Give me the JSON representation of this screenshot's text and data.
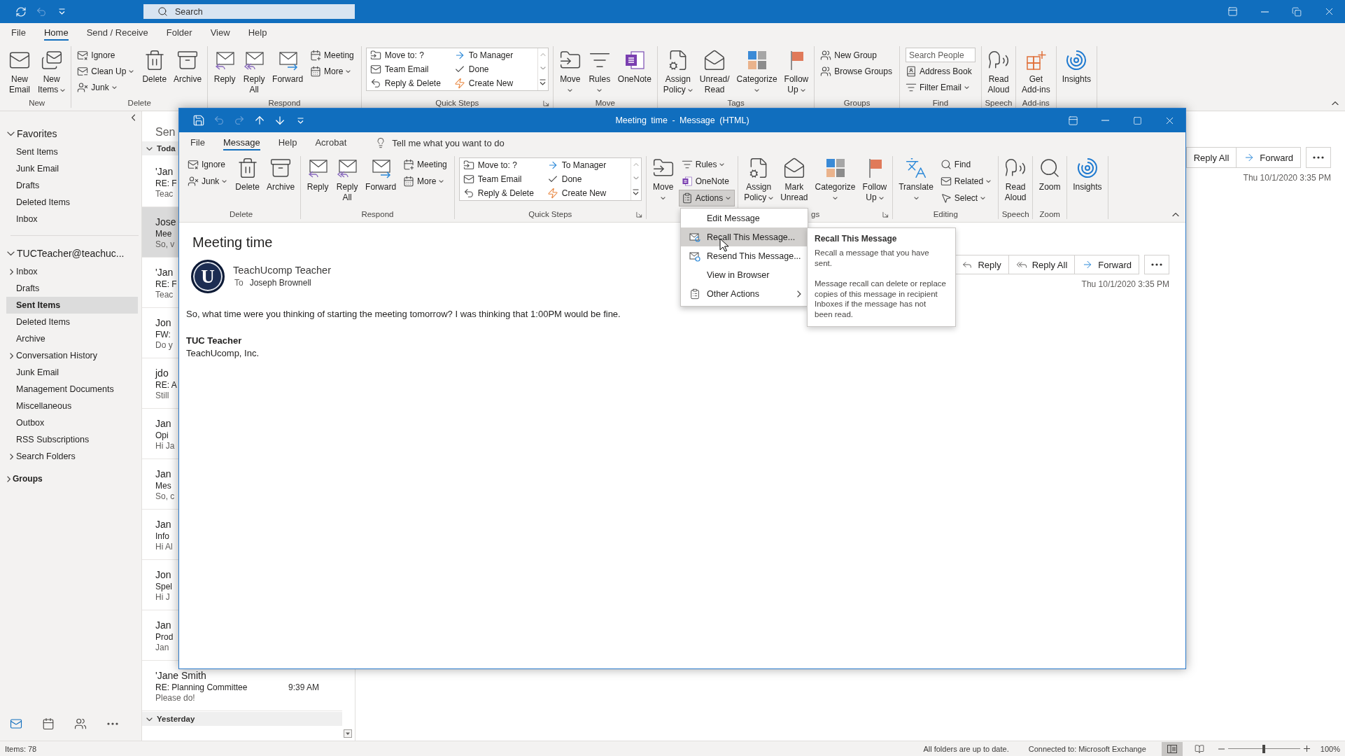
{
  "main_window": {
    "quick_access": [
      {
        "kind": "sync",
        "disabled": false
      },
      {
        "kind": "undo",
        "disabled": true
      },
      {
        "kind": "customize",
        "disabled": false
      }
    ],
    "search": {
      "placeholder": "Search"
    },
    "tabs": [
      {
        "label": "File",
        "selected": false
      },
      {
        "label": "Home",
        "selected": true
      },
      {
        "label": "Send / Receive",
        "selected": false
      },
      {
        "label": "Folder",
        "selected": false
      },
      {
        "label": "View",
        "selected": false
      },
      {
        "label": "Help",
        "selected": false
      }
    ],
    "ribbon": [
      {
        "label": "New",
        "items": [
          {
            "kind": "large",
            "lines": [
              "New",
              "Email"
            ],
            "dropdown": false
          },
          {
            "kind": "large",
            "lines": [
              "New",
              "Items"
            ],
            "dropdown": true
          }
        ]
      },
      {
        "label": "Delete",
        "items": [
          {
            "kind": "stack",
            "buttons": [
              {
                "kind": "button",
                "label": "Ignore",
                "dropdown": false,
                "expanded": false
              },
              {
                "kind": "button",
                "label": "Clean Up",
                "dropdown": true,
                "expanded": false
              },
              {
                "kind": "button",
                "label": "Junk",
                "dropdown": true,
                "expanded": false
              }
            ]
          },
          {
            "kind": "large",
            "lines": [
              "Delete"
            ],
            "dropdown": false
          },
          {
            "kind": "large",
            "lines": [
              "Archive"
            ],
            "dropdown": false
          }
        ]
      },
      {
        "label": "Respond",
        "items": [
          {
            "kind": "large",
            "lines": [
              "Reply"
            ],
            "dropdown": false
          },
          {
            "kind": "large",
            "lines": [
              "Reply",
              "All"
            ],
            "dropdown": false
          },
          {
            "kind": "large",
            "lines": [
              "Forward"
            ],
            "dropdown": false
          },
          {
            "kind": "stack",
            "buttons": [
              {
                "kind": "button",
                "label": "Meeting",
                "dropdown": false,
                "expanded": false
              },
              {
                "kind": "button",
                "label": "More",
                "dropdown": true,
                "expanded": false
              }
            ]
          }
        ]
      },
      {
        "label": "Quick Steps",
        "launcher": true,
        "items": [
          {
            "kind": "gallery",
            "entries": [
              "Move to: ?",
              "Team Email",
              "Reply & Delete",
              "To Manager",
              "Done",
              "Create New"
            ]
          }
        ]
      },
      {
        "label": "Move",
        "items": [
          {
            "kind": "large",
            "lines": [
              "Move"
            ],
            "dropdown": true
          },
          {
            "kind": "large",
            "lines": [
              "Rules"
            ],
            "dropdown": true
          },
          {
            "kind": "large",
            "lines": [
              "OneNote"
            ],
            "dropdown": false
          }
        ]
      },
      {
        "label": "Tags",
        "items": [
          {
            "kind": "large",
            "lines": [
              "Assign",
              "Policy"
            ],
            "dropdown": true
          },
          {
            "kind": "large",
            "lines": [
              "Unread/",
              "Read"
            ],
            "dropdown": false
          },
          {
            "kind": "large",
            "lines": [
              "Categorize"
            ],
            "dropdown": true
          },
          {
            "kind": "large",
            "lines": [
              "Follow",
              "Up"
            ],
            "dropdown": true
          }
        ]
      },
      {
        "label": "Groups",
        "items": [
          {
            "kind": "stack",
            "buttons": [
              {
                "kind": "button",
                "label": "New Group",
                "dropdown": false,
                "expanded": false
              },
              {
                "kind": "button",
                "label": "Browse Groups",
                "dropdown": false,
                "expanded": false
              }
            ]
          }
        ]
      },
      {
        "label": "Find",
        "items": [
          {
            "kind": "stack",
            "buttons": [
              {
                "kind": "field",
                "placeholder": "Search People"
              },
              {
                "kind": "button",
                "label": "Address Book",
                "dropdown": false,
                "expanded": false
              },
              {
                "kind": "button",
                "label": "Filter Email",
                "dropdown": true,
                "expanded": false
              }
            ]
          }
        ]
      },
      {
        "label": "Speech",
        "items": [
          {
            "kind": "large",
            "lines": [
              "Read",
              "Aloud"
            ],
            "dropdown": false
          }
        ]
      },
      {
        "label": "Add-ins",
        "items": [
          {
            "kind": "large",
            "lines": [
              "Get",
              "Add-ins"
            ],
            "dropdown": false
          }
        ]
      },
      {
        "items": [
          {
            "kind": "large",
            "lines": [
              "Insights"
            ],
            "dropdown": false
          }
        ]
      }
    ],
    "folder_pane": {
      "sections": [
        {
          "label": "Favorites",
          "kind": "pane",
          "expanded": true,
          "children": [
            {
              "label": "Sent Items",
              "expandable": false,
              "selected": false
            },
            {
              "label": "Junk Email",
              "expandable": false,
              "selected": false
            },
            {
              "label": "Drafts",
              "expandable": false,
              "selected": false
            },
            {
              "label": "Deleted Items",
              "expandable": false,
              "selected": false
            },
            {
              "label": "Inbox",
              "expandable": false,
              "selected": false
            }
          ]
        },
        {
          "label": "TUCTeacher@teachuc...",
          "kind": "pane",
          "expanded": true,
          "children": [
            {
              "label": "Inbox",
              "expandable": true,
              "selected": false
            },
            {
              "label": "Drafts",
              "expandable": false,
              "selected": false
            },
            {
              "label": "Sent Items",
              "expandable": false,
              "selected": true
            },
            {
              "label": "Deleted Items",
              "expandable": false,
              "selected": false
            },
            {
              "label": "Archive",
              "expandable": false,
              "selected": false
            },
            {
              "label": "Conversation History",
              "expandable": true,
              "selected": false
            },
            {
              "label": "Junk Email",
              "expandable": false,
              "selected": false
            },
            {
              "label": "Management Documents",
              "expandable": false,
              "selected": false
            },
            {
              "label": "Miscellaneous",
              "expandable": false,
              "selected": false
            },
            {
              "label": "Outbox",
              "expandable": false,
              "selected": false
            },
            {
              "label": "RSS Subscriptions",
              "expandable": false,
              "selected": false
            },
            {
              "label": "Search Folders",
              "expandable": true,
              "selected": false
            }
          ]
        },
        {
          "label": "Groups",
          "kind": "groups",
          "expanded": false
        }
      ]
    },
    "nav": [
      {
        "kind": "mail",
        "selected": true
      },
      {
        "kind": "calendar",
        "selected": false
      },
      {
        "kind": "people",
        "selected": false
      },
      {
        "kind": "more",
        "selected": false
      }
    ],
    "message_list": {
      "title": "Sen",
      "groups": [
        {
          "label": "Toda",
          "expanded": true,
          "messages": [
            {
              "sender": "'Jan",
              "subject": "RE: F",
              "preview": "Teac",
              "selected": false
            },
            {
              "sender": "Jose",
              "subject": "Mee",
              "preview": "So, v",
              "selected": true
            },
            {
              "sender": "'Jan",
              "subject": "RE: F",
              "preview": "Teac",
              "selected": false
            },
            {
              "sender": "Jon",
              "subject": "FW:",
              "preview": "Do y",
              "selected": false
            },
            {
              "sender": "jdo",
              "subject": "RE: A",
              "preview": "Still",
              "selected": false
            },
            {
              "sender": "Jan",
              "subject": "Opi",
              "preview": "Hi Ja",
              "selected": false
            },
            {
              "sender": "Jan",
              "subject": "Mes",
              "preview": "So, c",
              "selected": false
            },
            {
              "sender": "Jan",
              "subject": "Info",
              "preview": "Hi Al",
              "selected": false
            },
            {
              "sender": "Jon",
              "subject": "Spel",
              "preview": "Hi J",
              "selected": false
            },
            {
              "sender": "Jan",
              "subject": "Prod",
              "preview": "Jan",
              "selected": false
            },
            {
              "sender": "'Jane Smith",
              "subject": "RE: Planning Committee",
              "time": "9:39 AM",
              "preview": "Please do!",
              "selected": false
            }
          ]
        },
        {
          "label": "Yesterday",
          "expanded": true
        }
      ]
    },
    "reading_pane": {
      "actions": [
        {
          "label": "Reply All",
          "icon": false
        },
        {
          "label": "Forward",
          "icon": true
        }
      ],
      "date": "Thu 10/1/2020 3:35 PM"
    },
    "status_bar": {
      "items": "Items: 78",
      "sync": "All folders are up to date.",
      "connection": "Connected to: Microsoft Exchange",
      "views": [
        {
          "kind": "normal",
          "selected": true
        },
        {
          "kind": "reading",
          "selected": false
        }
      ],
      "zoom": {
        "level": 0.5,
        "reading": "100%"
      }
    }
  },
  "message_window": {
    "title": "Meeting time - Message (HTML)",
    "quick_access": [
      {
        "kind": "save",
        "disabled": false
      },
      {
        "kind": "undo",
        "disabled": true
      },
      {
        "kind": "redo",
        "disabled": true
      },
      {
        "kind": "up",
        "disabled": false
      },
      {
        "kind": "down",
        "disabled": false
      },
      {
        "kind": "customize",
        "disabled": false
      }
    ],
    "tabs": [
      {
        "label": "File",
        "selected": false
      },
      {
        "label": "Message",
        "selected": true
      },
      {
        "label": "Help",
        "selected": false
      },
      {
        "label": "Acrobat",
        "selected": false
      }
    ],
    "tell_me": {
      "placeholder": "Tell me what you want to do"
    },
    "ribbon": [
      {
        "label": "Delete",
        "items": [
          {
            "kind": "stack",
            "buttons": [
              {
                "kind": "button",
                "label": "Ignore",
                "dropdown": false,
                "expanded": false
              },
              {
                "kind": "button",
                "label": "Junk",
                "dropdown": true,
                "expanded": false
              }
            ]
          },
          {
            "kind": "large",
            "lines": [
              "Delete"
            ],
            "dropdown": false
          },
          {
            "kind": "large",
            "lines": [
              "Archive"
            ],
            "dropdown": false
          }
        ]
      },
      {
        "label": "Respond",
        "items": [
          {
            "kind": "large",
            "lines": [
              "Reply"
            ],
            "dropdown": false
          },
          {
            "kind": "large",
            "lines": [
              "Reply",
              "All"
            ],
            "dropdown": false
          },
          {
            "kind": "large",
            "lines": [
              "Forward"
            ],
            "dropdown": false
          },
          {
            "kind": "stack",
            "buttons": [
              {
                "kind": "button",
                "label": "Meeting",
                "dropdown": false,
                "expanded": false
              },
              {
                "kind": "button",
                "label": "More",
                "dropdown": true,
                "expanded": false
              }
            ]
          }
        ]
      },
      {
        "label": "Quick Steps",
        "launcher": true,
        "items": [
          {
            "kind": "gallery",
            "entries": [
              "Move to: ?",
              "Team Email",
              "Reply & Delete",
              "To Manager",
              "Done",
              "Create New"
            ]
          }
        ]
      },
      {
        "items": [
          {
            "kind": "large",
            "lines": [
              "Move"
            ],
            "dropdown": true
          },
          {
            "kind": "stack",
            "buttons": [
              {
                "kind": "button",
                "label": "Rules",
                "dropdown": true,
                "expanded": false
              },
              {
                "kind": "button",
                "label": "OneNote",
                "dropdown": false,
                "expanded": false
              },
              {
                "kind": "button",
                "label": "Actions",
                "dropdown": true,
                "expanded": true
              }
            ]
          }
        ]
      },
      {
        "label": "gs",
        "launcher": true,
        "items": [
          {
            "kind": "large",
            "lines": [
              "Assign",
              "Policy"
            ],
            "dropdown": true
          },
          {
            "kind": "large",
            "lines": [
              "Mark",
              "Unread"
            ],
            "dropdown": false
          },
          {
            "kind": "large",
            "lines": [
              "Categorize"
            ],
            "dropdown": true
          },
          {
            "kind": "large",
            "lines": [
              "Follow",
              "Up"
            ],
            "dropdown": true
          }
        ]
      },
      {
        "label": "Editing",
        "items": [
          {
            "kind": "large",
            "lines": [
              "Translate"
            ],
            "dropdown": true
          },
          {
            "kind": "stack",
            "buttons": [
              {
                "kind": "button",
                "label": "Find",
                "dropdown": false,
                "expanded": false
              },
              {
                "kind": "button",
                "label": "Related",
                "dropdown": true,
                "expanded": false
              },
              {
                "kind": "button",
                "label": "Select",
                "dropdown": true,
                "expanded": false
              }
            ]
          }
        ]
      },
      {
        "label": "Speech",
        "items": [
          {
            "kind": "large",
            "lines": [
              "Read",
              "Aloud"
            ],
            "dropdown": false
          }
        ]
      },
      {
        "label": "Zoom",
        "items": [
          {
            "kind": "large",
            "lines": [
              "Zoom"
            ],
            "dropdown": false
          }
        ]
      },
      {
        "items": [
          {
            "kind": "large",
            "lines": [
              "Insights"
            ],
            "dropdown": false
          }
        ]
      }
    ],
    "actions_menu": {
      "items": [
        {
          "label": "Edit Message",
          "selected": false,
          "submenu": false
        },
        {
          "label": "Recall This Message...",
          "selected": true,
          "submenu": false
        },
        {
          "label": "Resend This Message...",
          "selected": false,
          "submenu": false
        },
        {
          "label": "View in Browser",
          "selected": false,
          "submenu": false
        },
        {
          "label": "Other Actions",
          "selected": false,
          "submenu": true
        }
      ]
    },
    "tooltip": {
      "title": "Recall This Message",
      "paragraphs": [
        {
          "lines": [
            "Recall a message that you have",
            "sent."
          ]
        },
        {
          "lines": [
            "Message recall can delete or replace",
            "copies of this message in recipient",
            "Inboxes if the message has not",
            "been read."
          ]
        }
      ]
    },
    "message": {
      "subject": "Meeting time",
      "avatar": {
        "initial": "U"
      },
      "sender": "TeachUcomp Teacher",
      "to_label": "To",
      "recipient": "Joseph Brownell",
      "actions": [
        {
          "label": "Reply"
        },
        {
          "label": "Reply All"
        },
        {
          "label": "Forward"
        }
      ],
      "date": "Thu 10/1/2020 3:35 PM",
      "body": [
        "So, what time were you thinking of starting the meeting tomorrow? I was thinking that 1:00PM would be fine."
      ],
      "signature": [
        "TUC Teacher",
        "TeachUcomp, Inc."
      ]
    }
  }
}
